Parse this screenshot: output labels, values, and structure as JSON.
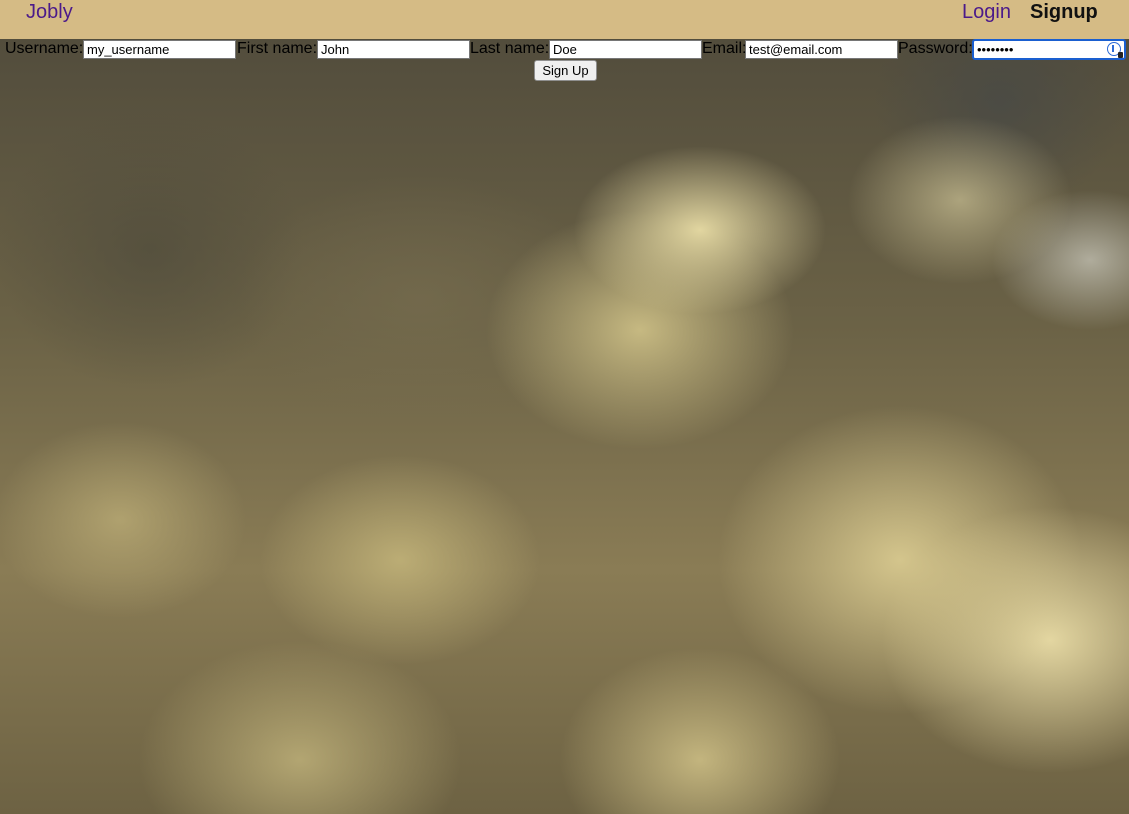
{
  "nav": {
    "brand": "Jobly",
    "login": "Login",
    "signup": "Signup"
  },
  "form": {
    "username_label": "Username:",
    "username_value": "my_username",
    "firstname_label": "First name:",
    "firstname_value": "John",
    "lastname_label": "Last name:",
    "lastname_value": "Doe",
    "email_label": "Email:",
    "email_value": "test@email.com",
    "password_label": "Password:",
    "password_value": "password",
    "submit_label": "Sign Up"
  },
  "colors": {
    "navbar_bg": "#d5bb85",
    "link": "#4b1a8a",
    "focus_ring": "#1a5fd0"
  },
  "icons": {
    "password_field": "password-key-icon"
  }
}
